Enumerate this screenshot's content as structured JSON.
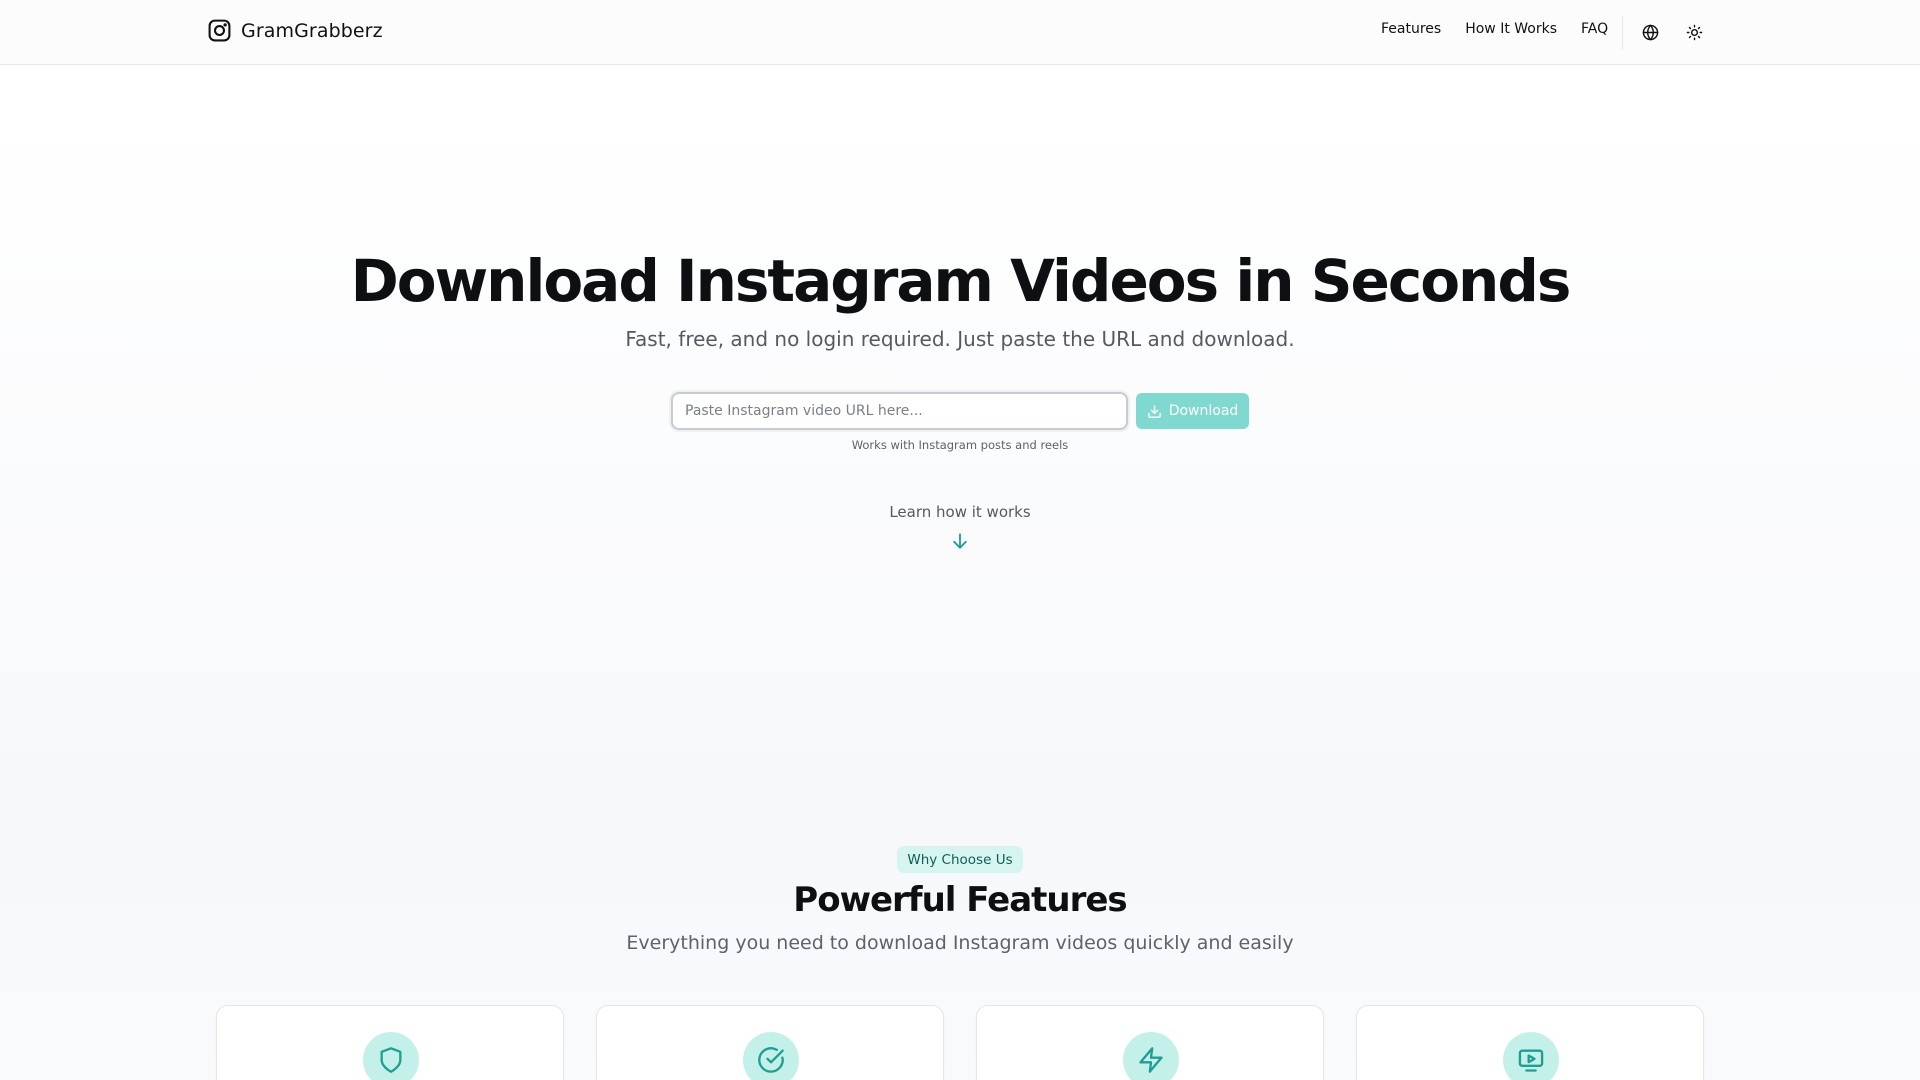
{
  "header": {
    "brand": "GramGrabberz",
    "nav": [
      "Features",
      "How It Works",
      "FAQ"
    ],
    "icons": [
      "instagram-icon",
      "globe-icon",
      "sun-icon"
    ]
  },
  "hero": {
    "title": "Download Instagram Videos in Seconds",
    "subtitle": "Fast, free, and no login required. Just paste the URL and download.",
    "input_placeholder": "Paste Instagram video URL here...",
    "input_value": "",
    "download_label": "Download",
    "hint": "Works with Instagram posts and reels",
    "learn_more": "Learn how it works"
  },
  "features": {
    "badge": "Why Choose Us",
    "title": "Powerful Features",
    "subtitle": "Everything you need to download Instagram videos quickly and easily",
    "cards": [
      {
        "icon": "shield-icon"
      },
      {
        "icon": "check-circle-icon"
      },
      {
        "icon": "lightning-icon"
      },
      {
        "icon": "video-play-icon"
      }
    ]
  },
  "colors": {
    "accent": "#7fd9d1",
    "accent_dark": "#1f9e92",
    "badge_bg": "#d6f5f1",
    "icon_circle_bg": "#c4f0ea"
  }
}
